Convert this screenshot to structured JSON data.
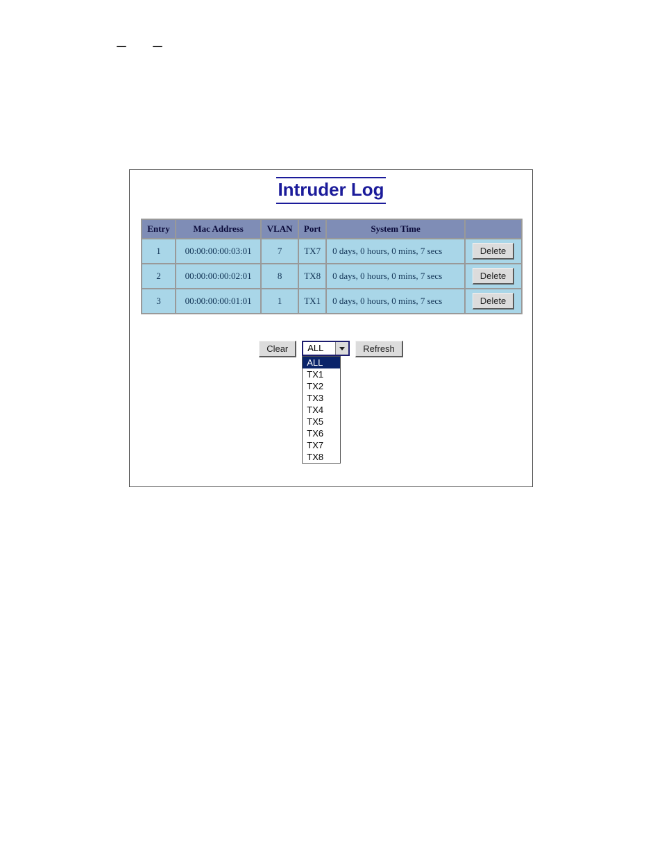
{
  "panel": {
    "title": "Intruder Log"
  },
  "table": {
    "headers": {
      "entry": "Entry",
      "mac": "Mac Address",
      "vlan": "VLAN",
      "port": "Port",
      "time": "System Time"
    },
    "rows": [
      {
        "entry": "1",
        "mac": "00:00:00:00:03:01",
        "vlan": "7",
        "port": "TX7",
        "time": "0 days, 0 hours, 0 mins, 7 secs",
        "delete_label": "Delete"
      },
      {
        "entry": "2",
        "mac": "00:00:00:00:02:01",
        "vlan": "8",
        "port": "TX8",
        "time": "0 days, 0 hours, 0 mins, 7 secs",
        "delete_label": "Delete"
      },
      {
        "entry": "3",
        "mac": "00:00:00:00:01:01",
        "vlan": "1",
        "port": "TX1",
        "time": "0 days, 0 hours, 0 mins, 7 secs",
        "delete_label": "Delete"
      }
    ]
  },
  "controls": {
    "clear_label": "Clear",
    "refresh_label": "Refresh",
    "filter": {
      "value": "ALL",
      "options": [
        "ALL",
        "TX1",
        "TX2",
        "TX3",
        "TX4",
        "TX5",
        "TX6",
        "TX7",
        "TX8"
      ]
    }
  }
}
